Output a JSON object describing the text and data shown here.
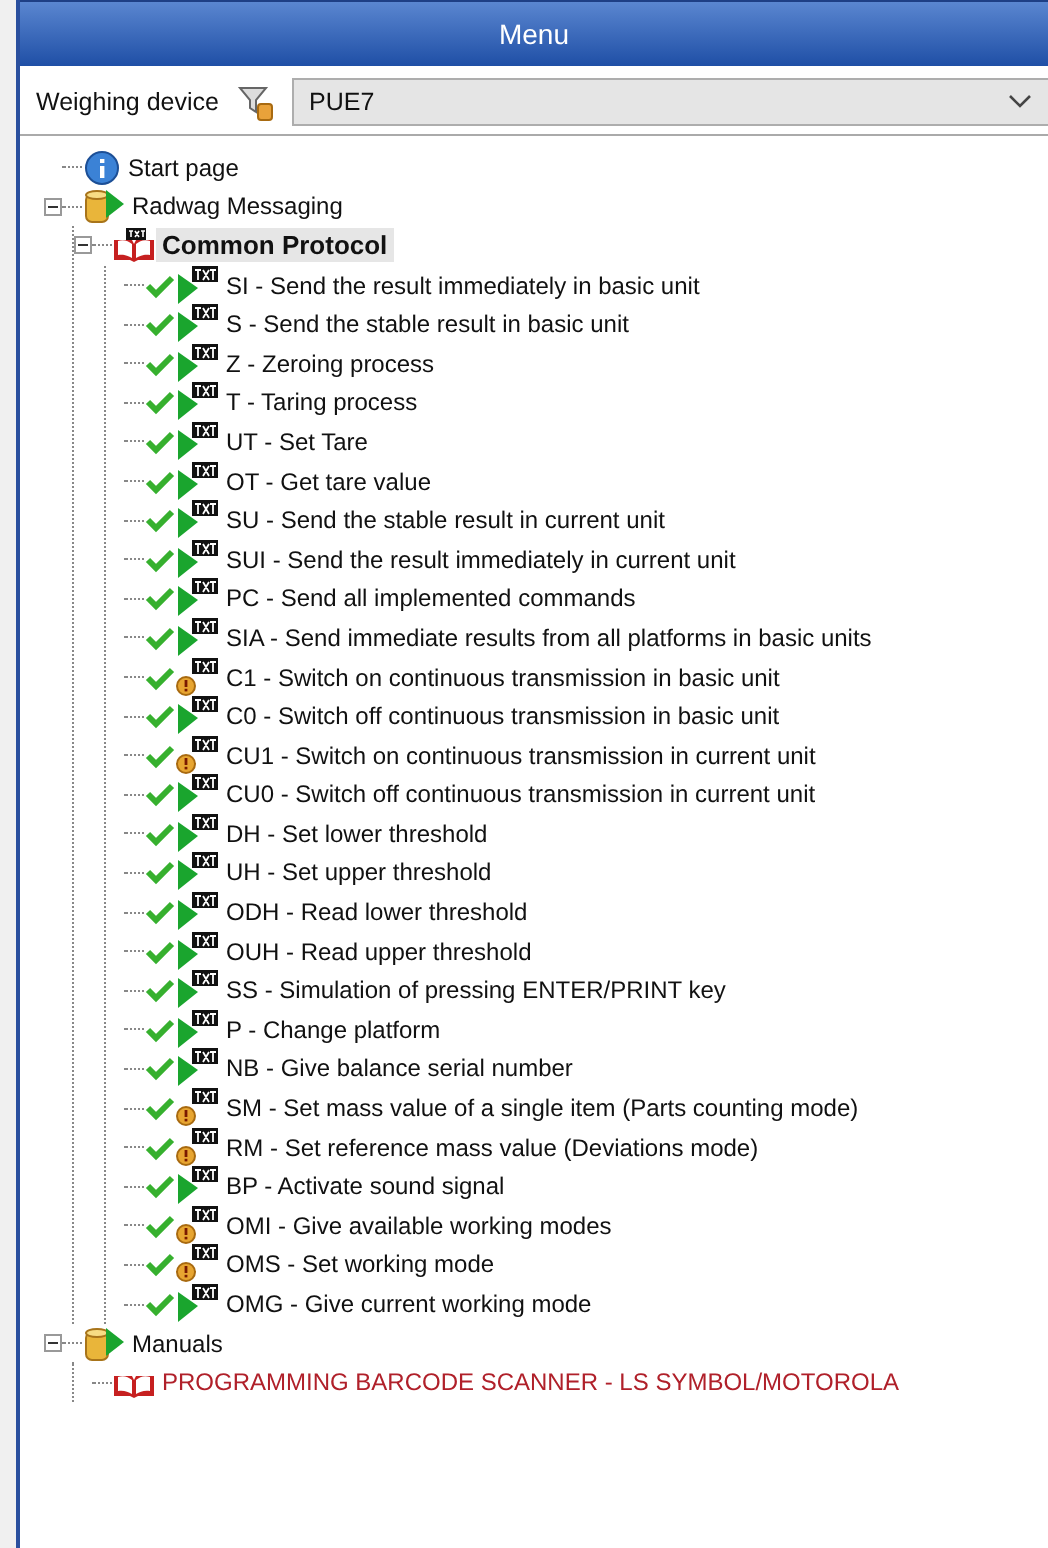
{
  "window": {
    "title": "Menu"
  },
  "device_selector": {
    "label": "Weighing device",
    "value": "PUE7"
  },
  "tree": [
    {
      "label": "Start page",
      "kind": "info",
      "selected": false
    },
    {
      "label": "Radwag Messaging",
      "kind": "folder",
      "expanded": true,
      "selected": false,
      "children": [
        {
          "label": "Common Protocol",
          "kind": "book",
          "expanded": true,
          "selected": true,
          "children": [
            {
              "label": "SI - Send the result immediately in basic unit",
              "kind": "play",
              "selected": false
            },
            {
              "label": "S - Send the stable result in basic unit",
              "kind": "play",
              "selected": false
            },
            {
              "label": "Z - Zeroing process",
              "kind": "play",
              "selected": false
            },
            {
              "label": "T - Taring process",
              "kind": "play",
              "selected": false
            },
            {
              "label": "UT - Set Tare",
              "kind": "play",
              "selected": false
            },
            {
              "label": "OT - Get tare value",
              "kind": "play",
              "selected": false
            },
            {
              "label": "SU - Send the stable result in current unit",
              "kind": "play",
              "selected": false
            },
            {
              "label": "SUI - Send the result immediately in current unit",
              "kind": "play",
              "selected": false
            },
            {
              "label": "PC - Send all implemented commands",
              "kind": "play",
              "selected": false
            },
            {
              "label": "SIA - Send immediate results from all platforms in basic units",
              "kind": "play",
              "selected": false
            },
            {
              "label": "C1 - Switch on continuous transmission in basic unit",
              "kind": "warning",
              "selected": false
            },
            {
              "label": "C0 - Switch off continuous transmission in basic unit",
              "kind": "play",
              "selected": false
            },
            {
              "label": "CU1 - Switch on continuous transmission in current unit",
              "kind": "warning",
              "selected": false
            },
            {
              "label": "CU0 - Switch off continuous transmission in current unit",
              "kind": "play",
              "selected": false
            },
            {
              "label": "DH - Set lower threshold",
              "kind": "play",
              "selected": false
            },
            {
              "label": "UH - Set upper threshold",
              "kind": "play",
              "selected": false
            },
            {
              "label": "ODH - Read lower threshold",
              "kind": "play",
              "selected": false
            },
            {
              "label": "OUH - Read upper threshold",
              "kind": "play",
              "selected": false
            },
            {
              "label": "SS - Simulation of pressing ENTER/PRINT key",
              "kind": "play",
              "selected": false
            },
            {
              "label": "P - Change platform",
              "kind": "play",
              "selected": false
            },
            {
              "label": "NB - Give balance serial number",
              "kind": "play",
              "selected": false
            },
            {
              "label": "SM - Set mass value of a single item (Parts counting mode)",
              "kind": "warning",
              "selected": false
            },
            {
              "label": "RM - Set reference mass value (Deviations mode)",
              "kind": "warning",
              "selected": false
            },
            {
              "label": "BP - Activate sound signal",
              "kind": "play",
              "selected": false
            },
            {
              "label": "OMI - Give available working modes",
              "kind": "warning",
              "selected": false
            },
            {
              "label": "OMS - Set working mode",
              "kind": "warning",
              "selected": false
            },
            {
              "label": "OMG - Give current working mode",
              "kind": "play",
              "selected": false
            }
          ]
        }
      ]
    },
    {
      "label": "Manuals",
      "kind": "folder",
      "expanded": true,
      "selected": false,
      "children": [
        {
          "label": "PROGRAMMING BARCODE SCANNER - LS SYMBOL/MOTOROLA",
          "kind": "manual",
          "selected": false
        }
      ]
    }
  ]
}
